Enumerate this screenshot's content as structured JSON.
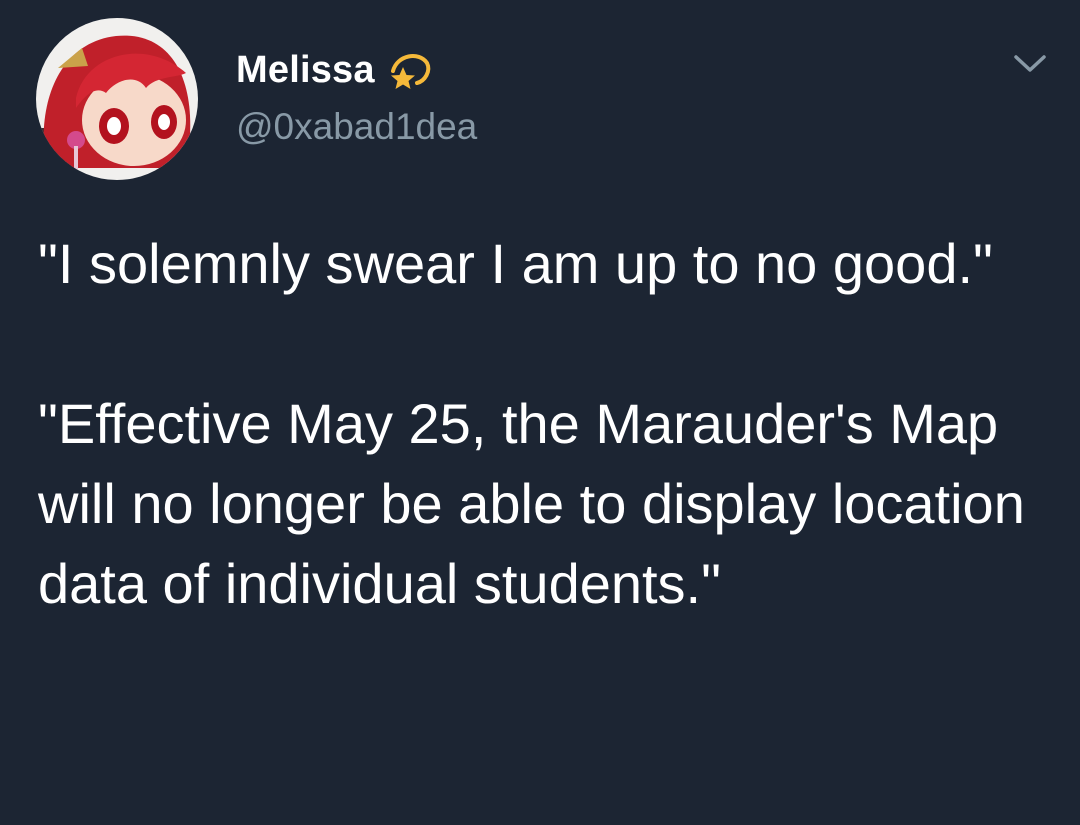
{
  "tweet": {
    "author": {
      "display_name": "Melissa",
      "handle": "@0xabad1dea",
      "avatar_icon": "avatar-anime-girl-red-hair",
      "name_emoji_icon": "shooting-star-icon"
    },
    "menu_icon": "chevron-down-icon",
    "text": "\"I solemnly swear I am up to no good.\"\n\n\"Effective May 25, the Marauder's Map will no longer be able to display location data of individual students.\"",
    "colors": {
      "background": "#1c2533",
      "text": "#ffffff",
      "handle": "#8899a6",
      "chevron": "#8899a6"
    }
  }
}
